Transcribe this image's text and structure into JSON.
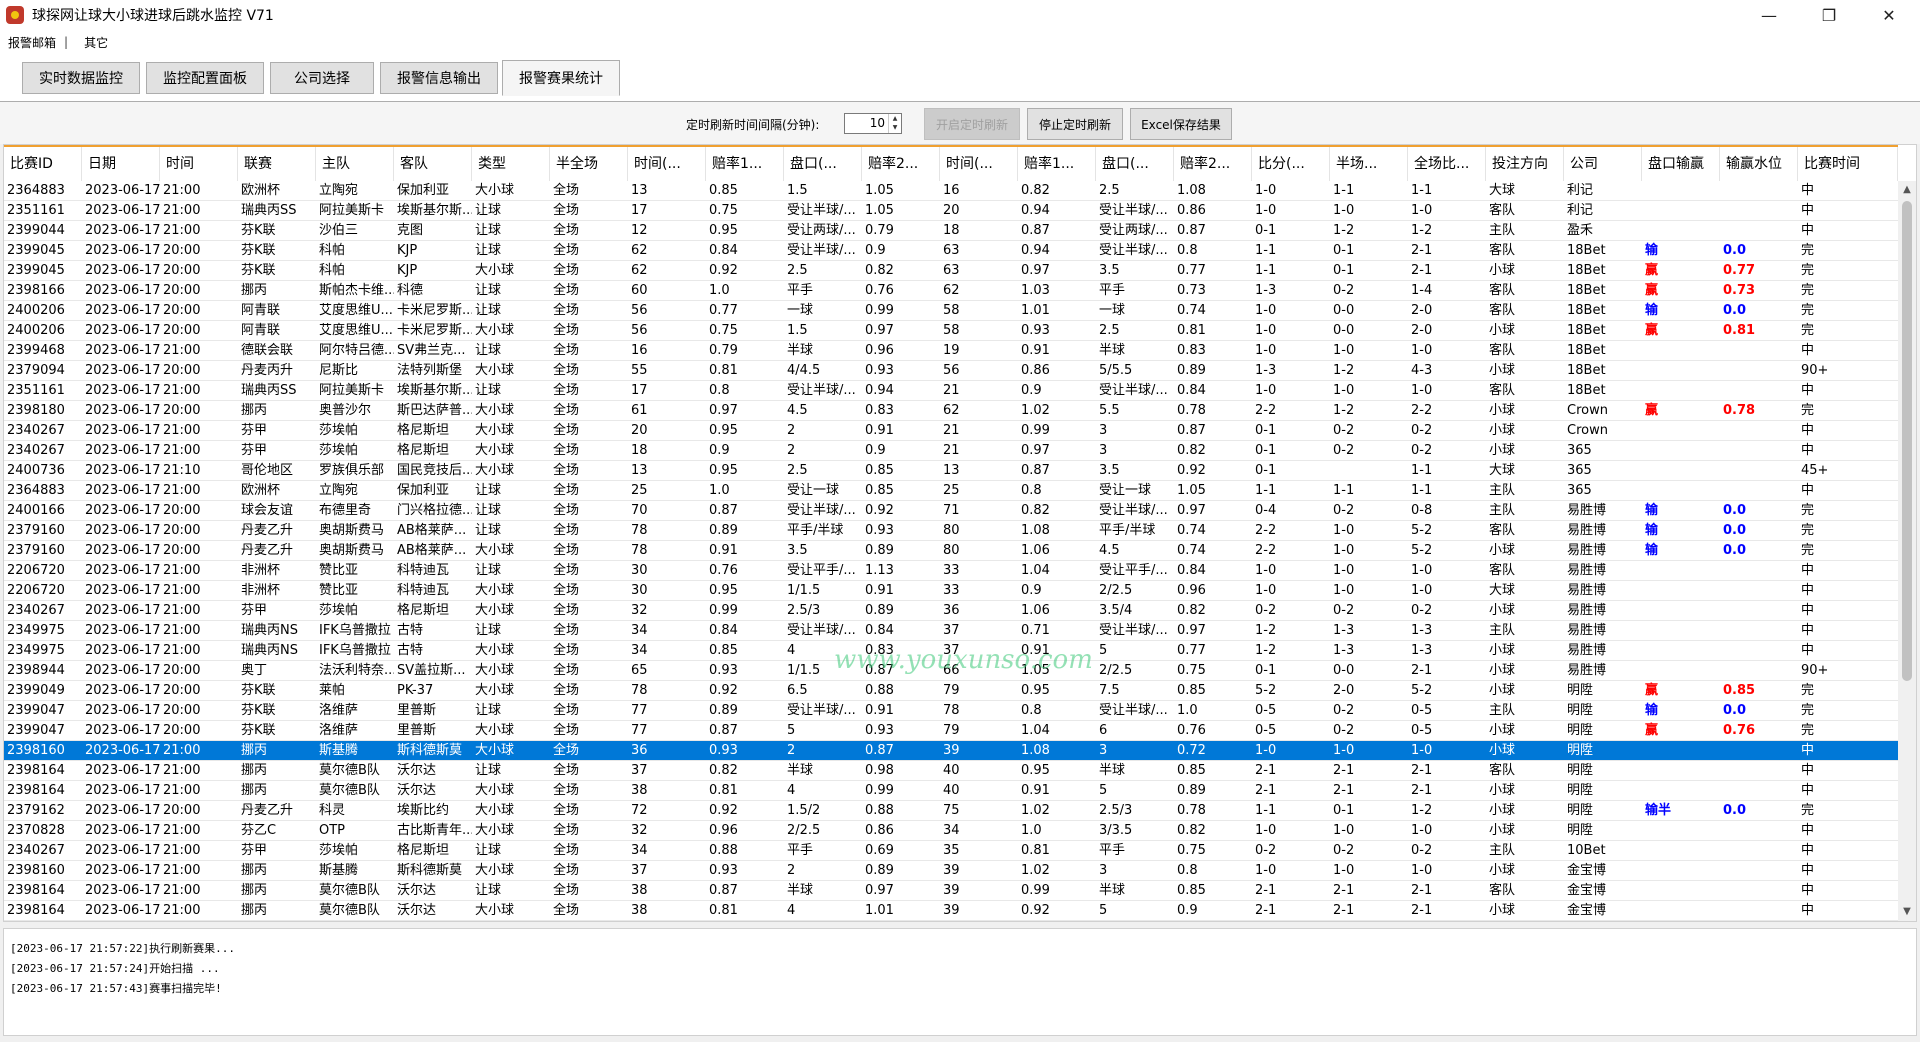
{
  "window": {
    "title": "球探网让球大小球进球后跳水监控 V71",
    "min": "—",
    "max": "❐",
    "close": "✕"
  },
  "menu": [
    "报警邮箱",
    "|",
    "其它"
  ],
  "tabs": [
    "实时数据监控",
    "监控配置面板",
    "公司选择",
    "报警信息输出",
    "报警赛果统计"
  ],
  "controls": {
    "interval_label": "定时刷新时间间隔(分钟):",
    "interval_value": "10",
    "start_button": "开启定时刷新",
    "stop_button": "停止定时刷新",
    "excel_button": "Excel保存结果"
  },
  "columns": [
    "比赛ID",
    "日期",
    "时间",
    "联赛",
    "主队",
    "客队",
    "类型",
    "半全场",
    "时间(...",
    "赔率1...",
    "盘口(...",
    "赔率2...",
    "时间(...",
    "赔率1...",
    "盘口(...",
    "赔率2...",
    "比分(...",
    "半场...",
    "全场比...",
    "投注方向",
    "公司",
    "盘口输赢",
    "输赢水位",
    "比赛时间"
  ],
  "rows": [
    [
      "2364883",
      "2023-06-17",
      "21:00",
      "欧洲杯",
      "立陶宛",
      "保加利亚",
      "大小球",
      "全场",
      "13",
      "0.85",
      "1.5",
      "1.05",
      "16",
      "0.82",
      "2.5",
      "1.08",
      "1-0",
      "1-1",
      "1-1",
      "大球",
      "利记",
      "",
      "",
      "中"
    ],
    [
      "2351161",
      "2023-06-17",
      "21:00",
      "瑞典丙SS",
      "阿拉美斯卡",
      "埃斯基尔斯...",
      "让球",
      "全场",
      "17",
      "0.75",
      "受让半球/...",
      "1.05",
      "20",
      "0.94",
      "受让半球/...",
      "0.86",
      "1-0",
      "1-0",
      "1-0",
      "客队",
      "利记",
      "",
      "",
      "中"
    ],
    [
      "2399044",
      "2023-06-17",
      "21:00",
      "芬K联",
      "沙伯三",
      "克图",
      "让球",
      "全场",
      "12",
      "0.95",
      "受让两球/...",
      "0.79",
      "18",
      "0.87",
      "受让两球/...",
      "0.87",
      "0-1",
      "1-2",
      "1-2",
      "主队",
      "盈禾",
      "",
      "",
      "中"
    ],
    [
      "2399045",
      "2023-06-17",
      "20:00",
      "芬K联",
      "科帕",
      "KJP",
      "让球",
      "全场",
      "62",
      "0.84",
      "受让半球/...",
      "0.9",
      "63",
      "0.94",
      "受让半球/...",
      "0.8",
      "1-1",
      "0-1",
      "2-1",
      "客队",
      "18Bet",
      "输",
      "0.0",
      "完"
    ],
    [
      "2399045",
      "2023-06-17",
      "20:00",
      "芬K联",
      "科帕",
      "KJP",
      "大小球",
      "全场",
      "62",
      "0.92",
      "2.5",
      "0.82",
      "63",
      "0.97",
      "3.5",
      "0.77",
      "1-1",
      "0-1",
      "2-1",
      "小球",
      "18Bet",
      "赢",
      "0.77",
      "完"
    ],
    [
      "2398166",
      "2023-06-17",
      "20:00",
      "挪丙",
      "斯帕杰卡维...",
      "科德",
      "让球",
      "全场",
      "60",
      "1.0",
      "平手",
      "0.76",
      "62",
      "1.03",
      "平手",
      "0.73",
      "1-3",
      "0-2",
      "1-4",
      "客队",
      "18Bet",
      "赢",
      "0.73",
      "完"
    ],
    [
      "2400206",
      "2023-06-17",
      "20:00",
      "阿青联",
      "艾度思维U...",
      "卡米尼罗斯...",
      "让球",
      "全场",
      "56",
      "0.77",
      "一球",
      "0.99",
      "58",
      "1.01",
      "一球",
      "0.74",
      "1-0",
      "0-0",
      "2-0",
      "客队",
      "18Bet",
      "输",
      "0.0",
      "完"
    ],
    [
      "2400206",
      "2023-06-17",
      "20:00",
      "阿青联",
      "艾度思维U...",
      "卡米尼罗斯...",
      "大小球",
      "全场",
      "56",
      "0.75",
      "1.5",
      "0.97",
      "58",
      "0.93",
      "2.5",
      "0.81",
      "1-0",
      "0-0",
      "2-0",
      "小球",
      "18Bet",
      "赢",
      "0.81",
      "完"
    ],
    [
      "2399468",
      "2023-06-17",
      "21:00",
      "德联会联",
      "阿尔特吕德...",
      "SV弗兰克...",
      "让球",
      "全场",
      "16",
      "0.79",
      "半球",
      "0.96",
      "19",
      "0.91",
      "半球",
      "0.83",
      "1-0",
      "1-0",
      "1-0",
      "客队",
      "18Bet",
      "",
      "",
      "中"
    ],
    [
      "2379094",
      "2023-06-17",
      "20:00",
      "丹麦丙升",
      "尼斯比",
      "法特列斯堡",
      "大小球",
      "全场",
      "55",
      "0.81",
      "4/4.5",
      "0.93",
      "56",
      "0.86",
      "5/5.5",
      "0.89",
      "1-3",
      "1-2",
      "4-3",
      "小球",
      "18Bet",
      "",
      "",
      "90+"
    ],
    [
      "2351161",
      "2023-06-17",
      "21:00",
      "瑞典丙SS",
      "阿拉美斯卡",
      "埃斯基尔斯...",
      "让球",
      "全场",
      "17",
      "0.8",
      "受让半球/...",
      "0.94",
      "21",
      "0.9",
      "受让半球/...",
      "0.84",
      "1-0",
      "1-0",
      "1-0",
      "客队",
      "18Bet",
      "",
      "",
      "中"
    ],
    [
      "2398180",
      "2023-06-17",
      "20:00",
      "挪丙",
      "奥普沙尔",
      "斯巴达萨普...",
      "大小球",
      "全场",
      "61",
      "0.97",
      "4.5",
      "0.83",
      "62",
      "1.02",
      "5.5",
      "0.78",
      "2-2",
      "1-2",
      "2-2",
      "小球",
      "Crown",
      "赢",
      "0.78",
      "完"
    ],
    [
      "2340267",
      "2023-06-17",
      "21:00",
      "芬甲",
      "莎埃帕",
      "格尼斯坦",
      "大小球",
      "全场",
      "20",
      "0.95",
      "2",
      "0.91",
      "21",
      "0.99",
      "3",
      "0.87",
      "0-1",
      "0-2",
      "0-2",
      "小球",
      "Crown",
      "",
      "",
      "中"
    ],
    [
      "2340267",
      "2023-06-17",
      "21:00",
      "芬甲",
      "莎埃帕",
      "格尼斯坦",
      "大小球",
      "全场",
      "18",
      "0.9",
      "2",
      "0.9",
      "21",
      "0.97",
      "3",
      "0.82",
      "0-1",
      "0-2",
      "0-2",
      "小球",
      "365",
      "",
      "",
      "中"
    ],
    [
      "2400736",
      "2023-06-17",
      "21:10",
      "哥伦地区",
      "罗族俱乐部",
      "国民竞技后...",
      "大小球",
      "全场",
      "13",
      "0.95",
      "2.5",
      "0.85",
      "13",
      "0.87",
      "3.5",
      "0.92",
      "0-1",
      "",
      "1-1",
      "大球",
      "365",
      "",
      "",
      "45+"
    ],
    [
      "2364883",
      "2023-06-17",
      "21:00",
      "欧洲杯",
      "立陶宛",
      "保加利亚",
      "让球",
      "全场",
      "25",
      "1.0",
      "受让一球",
      "0.85",
      "25",
      "0.8",
      "受让一球",
      "1.05",
      "1-1",
      "1-1",
      "1-1",
      "主队",
      "365",
      "",
      "",
      "中"
    ],
    [
      "2400166",
      "2023-06-17",
      "20:00",
      "球会友谊",
      "布德里奇",
      "门兴格拉德...",
      "让球",
      "全场",
      "70",
      "0.87",
      "受让半球/...",
      "0.92",
      "71",
      "0.82",
      "受让半球/...",
      "0.97",
      "0-4",
      "0-2",
      "0-8",
      "主队",
      "易胜博",
      "输",
      "0.0",
      "完"
    ],
    [
      "2379160",
      "2023-06-17",
      "20:00",
      "丹麦乙升",
      "奥胡斯费马",
      "AB格莱萨...",
      "让球",
      "全场",
      "78",
      "0.89",
      "平手/半球",
      "0.93",
      "80",
      "1.08",
      "平手/半球",
      "0.74",
      "2-2",
      "1-0",
      "5-2",
      "客队",
      "易胜博",
      "输",
      "0.0",
      "完"
    ],
    [
      "2379160",
      "2023-06-17",
      "20:00",
      "丹麦乙升",
      "奥胡斯费马",
      "AB格莱萨...",
      "大小球",
      "全场",
      "78",
      "0.91",
      "3.5",
      "0.89",
      "80",
      "1.06",
      "4.5",
      "0.74",
      "2-2",
      "1-0",
      "5-2",
      "小球",
      "易胜博",
      "输",
      "0.0",
      "完"
    ],
    [
      "2206720",
      "2023-06-17",
      "21:00",
      "非洲杯",
      "赞比亚",
      "科特迪瓦",
      "让球",
      "全场",
      "30",
      "0.76",
      "受让平手/...",
      "1.13",
      "33",
      "1.04",
      "受让平手/...",
      "0.84",
      "1-0",
      "1-0",
      "1-0",
      "客队",
      "易胜博",
      "",
      "",
      "中"
    ],
    [
      "2206720",
      "2023-06-17",
      "21:00",
      "非洲杯",
      "赞比亚",
      "科特迪瓦",
      "大小球",
      "全场",
      "30",
      "0.95",
      "1/1.5",
      "0.91",
      "33",
      "0.9",
      "2/2.5",
      "0.96",
      "1-0",
      "1-0",
      "1-0",
      "大球",
      "易胜博",
      "",
      "",
      "中"
    ],
    [
      "2340267",
      "2023-06-17",
      "21:00",
      "芬甲",
      "莎埃帕",
      "格尼斯坦",
      "大小球",
      "全场",
      "32",
      "0.99",
      "2.5/3",
      "0.89",
      "36",
      "1.06",
      "3.5/4",
      "0.82",
      "0-2",
      "0-2",
      "0-2",
      "小球",
      "易胜博",
      "",
      "",
      "中"
    ],
    [
      "2349975",
      "2023-06-17",
      "21:00",
      "瑞典丙NS",
      "IFK乌普撒拉",
      "古特",
      "让球",
      "全场",
      "34",
      "0.84",
      "受让半球/...",
      "0.84",
      "37",
      "0.71",
      "受让半球/...",
      "0.97",
      "1-2",
      "1-3",
      "1-3",
      "主队",
      "易胜博",
      "",
      "",
      "中"
    ],
    [
      "2349975",
      "2023-06-17",
      "21:00",
      "瑞典丙NS",
      "IFK乌普撒拉",
      "古特",
      "大小球",
      "全场",
      "34",
      "0.85",
      "4",
      "0.83",
      "37",
      "0.91",
      "5",
      "0.77",
      "1-2",
      "1-3",
      "1-3",
      "小球",
      "易胜博",
      "",
      "",
      "中"
    ],
    [
      "2398944",
      "2023-06-17",
      "20:00",
      "奥丁",
      "法沃利特奈...",
      "SV盖拉斯...",
      "大小球",
      "全场",
      "65",
      "0.93",
      "1/1.5",
      "0.87",
      "66",
      "1.05",
      "2/2.5",
      "0.75",
      "0-1",
      "0-0",
      "2-1",
      "小球",
      "易胜博",
      "",
      "",
      "90+"
    ],
    [
      "2399049",
      "2023-06-17",
      "20:00",
      "芬K联",
      "莱帕",
      "PK-37",
      "大小球",
      "全场",
      "78",
      "0.92",
      "6.5",
      "0.88",
      "79",
      "0.95",
      "7.5",
      "0.85",
      "5-2",
      "2-0",
      "5-2",
      "小球",
      "明陞",
      "赢",
      "0.85",
      "完"
    ],
    [
      "2399047",
      "2023-06-17",
      "20:00",
      "芬K联",
      "洛维萨",
      "里普斯",
      "让球",
      "全场",
      "77",
      "0.89",
      "受让半球/...",
      "0.91",
      "78",
      "0.8",
      "受让半球/...",
      "1.0",
      "0-5",
      "0-2",
      "0-5",
      "主队",
      "明陞",
      "输",
      "0.0",
      "完"
    ],
    [
      "2399047",
      "2023-06-17",
      "20:00",
      "芬K联",
      "洛维萨",
      "里普斯",
      "大小球",
      "全场",
      "77",
      "0.87",
      "5",
      "0.93",
      "79",
      "1.04",
      "6",
      "0.76",
      "0-5",
      "0-2",
      "0-5",
      "小球",
      "明陞",
      "赢",
      "0.76",
      "完"
    ],
    [
      "2398160",
      "2023-06-17",
      "21:00",
      "挪丙",
      "斯基腾",
      "斯科德斯莫",
      "大小球",
      "全场",
      "36",
      "0.93",
      "2",
      "0.87",
      "39",
      "1.08",
      "3",
      "0.72",
      "1-0",
      "1-0",
      "1-0",
      "小球",
      "明陞",
      "",
      "",
      "中"
    ],
    [
      "2398164",
      "2023-06-17",
      "21:00",
      "挪丙",
      "莫尔德B队",
      "沃尔达",
      "让球",
      "全场",
      "37",
      "0.82",
      "半球",
      "0.98",
      "40",
      "0.95",
      "半球",
      "0.85",
      "2-1",
      "2-1",
      "2-1",
      "客队",
      "明陞",
      "",
      "",
      "中"
    ],
    [
      "2398164",
      "2023-06-17",
      "21:00",
      "挪丙",
      "莫尔德B队",
      "沃尔达",
      "大小球",
      "全场",
      "38",
      "0.81",
      "4",
      "0.99",
      "40",
      "0.91",
      "5",
      "0.89",
      "2-1",
      "2-1",
      "2-1",
      "小球",
      "明陞",
      "",
      "",
      "中"
    ],
    [
      "2379162",
      "2023-06-17",
      "20:00",
      "丹麦乙升",
      "科灵",
      "埃斯比约",
      "大小球",
      "全场",
      "72",
      "0.92",
      "1.5/2",
      "0.88",
      "75",
      "1.02",
      "2.5/3",
      "0.78",
      "1-1",
      "0-1",
      "1-2",
      "小球",
      "明陞",
      "输半",
      "0.0",
      "完"
    ],
    [
      "2370828",
      "2023-06-17",
      "21:00",
      "芬乙C",
      "OTP",
      "古比斯青年...",
      "大小球",
      "全场",
      "32",
      "0.96",
      "2/2.5",
      "0.86",
      "34",
      "1.0",
      "3/3.5",
      "0.82",
      "1-0",
      "1-0",
      "1-0",
      "小球",
      "明陞",
      "",
      "",
      "中"
    ],
    [
      "2340267",
      "2023-06-17",
      "21:00",
      "芬甲",
      "莎埃帕",
      "格尼斯坦",
      "让球",
      "全场",
      "34",
      "0.88",
      "平手",
      "0.69",
      "35",
      "0.81",
      "平手",
      "0.75",
      "0-2",
      "0-2",
      "0-2",
      "主队",
      "10Bet",
      "",
      "",
      "中"
    ],
    [
      "2398160",
      "2023-06-17",
      "21:00",
      "挪丙",
      "斯基腾",
      "斯科德斯莫",
      "大小球",
      "全场",
      "37",
      "0.93",
      "2",
      "0.89",
      "39",
      "1.02",
      "3",
      "0.8",
      "1-0",
      "1-0",
      "1-0",
      "小球",
      "金宝博",
      "",
      "",
      "中"
    ],
    [
      "2398164",
      "2023-06-17",
      "21:00",
      "挪丙",
      "莫尔德B队",
      "沃尔达",
      "让球",
      "全场",
      "38",
      "0.87",
      "半球",
      "0.97",
      "39",
      "0.99",
      "半球",
      "0.85",
      "2-1",
      "2-1",
      "2-1",
      "客队",
      "金宝博",
      "",
      "",
      "中"
    ],
    [
      "2398164",
      "2023-06-17",
      "21:00",
      "挪丙",
      "莫尔德B队",
      "沃尔达",
      "大小球",
      "全场",
      "38",
      "0.81",
      "4",
      "1.01",
      "39",
      "0.92",
      "5",
      "0.9",
      "2-1",
      "2-1",
      "2-1",
      "小球",
      "金宝博",
      "",
      "",
      "中"
    ]
  ],
  "watermark": "www.youxunso.com",
  "log": [
    "[2023-06-17 21:57:22]执行刷新赛果...",
    "[2023-06-17 21:57:24]开始扫描 ...",
    "[2023-06-17 21:57:43]赛事扫描完毕!"
  ]
}
